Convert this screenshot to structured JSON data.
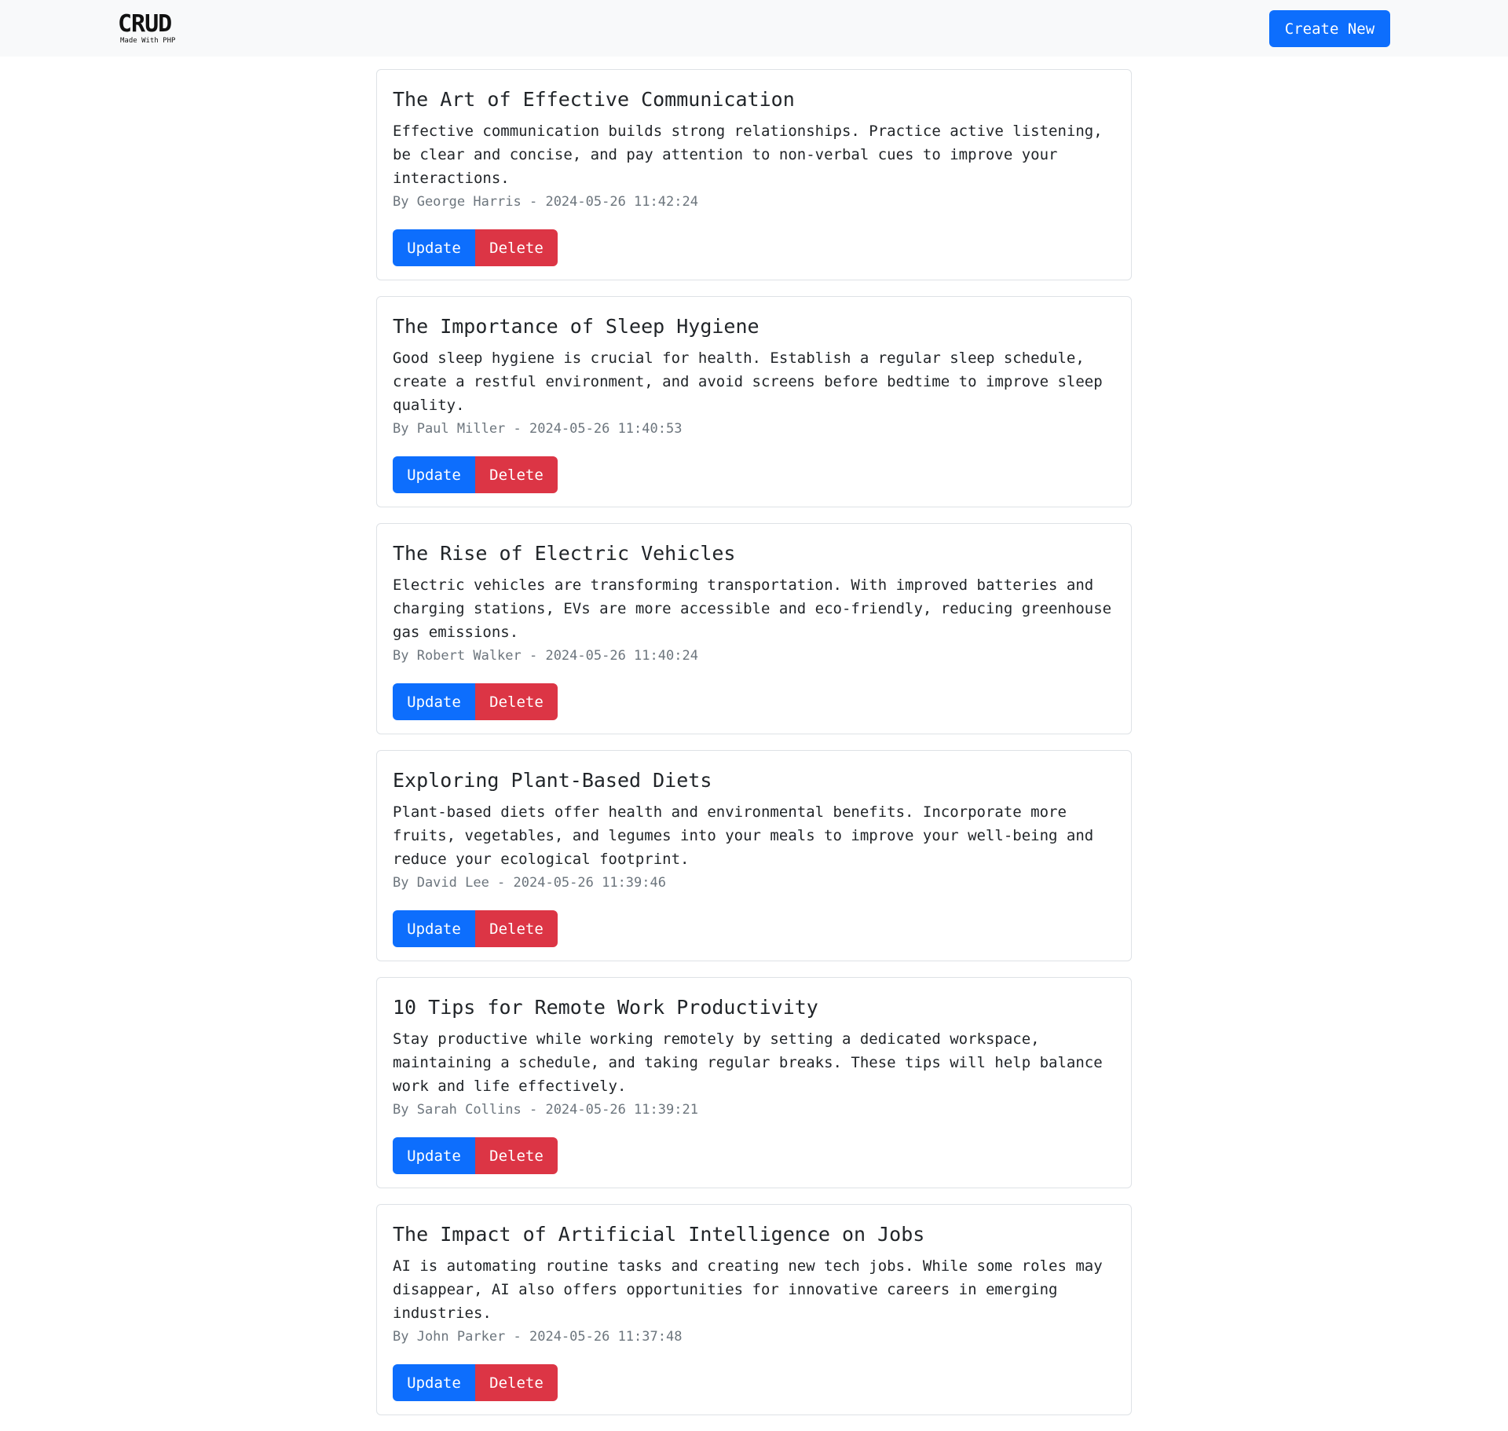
{
  "navbar": {
    "brand_title": "CRUD",
    "brand_subtitle": "Made With PHP",
    "create_label": "Create New"
  },
  "colors": {
    "primary": "#0d6efd",
    "danger": "#dc3545",
    "navbar_bg": "#f8f9fa",
    "muted": "#6c757d"
  },
  "posts": [
    {
      "title": "The Art of Effective Communication",
      "body": "Effective communication builds strong relationships. Practice active listening, be clear and concise, and pay attention to non-verbal cues to improve your interactions.",
      "meta": "By George Harris - 2024-05-26 11:42:24",
      "update_label": "Update",
      "delete_label": "Delete"
    },
    {
      "title": "The Importance of Sleep Hygiene",
      "body": "Good sleep hygiene is crucial for health. Establish a regular sleep schedule, create a restful environment, and avoid screens before bedtime to improve sleep quality.",
      "meta": "By Paul Miller - 2024-05-26 11:40:53",
      "update_label": "Update",
      "delete_label": "Delete"
    },
    {
      "title": "The Rise of Electric Vehicles",
      "body": "Electric vehicles are transforming transportation. With improved batteries and charging stations, EVs are more accessible and eco-friendly, reducing greenhouse gas emissions.",
      "meta": "By Robert Walker - 2024-05-26 11:40:24",
      "update_label": "Update",
      "delete_label": "Delete"
    },
    {
      "title": "Exploring Plant-Based Diets",
      "body": "Plant-based diets offer health and environmental benefits. Incorporate more fruits, vegetables, and legumes into your meals to improve your well-being and reduce your ecological footprint.",
      "meta": "By David Lee - 2024-05-26 11:39:46",
      "update_label": "Update",
      "delete_label": "Delete"
    },
    {
      "title": "10 Tips for Remote Work Productivity",
      "body": "Stay productive while working remotely by setting a dedicated workspace, maintaining a schedule, and taking regular breaks. These tips will help balance work and life effectively.",
      "meta": "By Sarah Collins - 2024-05-26 11:39:21",
      "update_label": "Update",
      "delete_label": "Delete"
    },
    {
      "title": "The Impact of Artificial Intelligence on Jobs",
      "body": "AI is automating routine tasks and creating new tech jobs. While some roles may disappear, AI also offers opportunities for innovative careers in emerging industries.",
      "meta": "By John Parker - 2024-05-26 11:37:48",
      "update_label": "Update",
      "delete_label": "Delete"
    }
  ]
}
